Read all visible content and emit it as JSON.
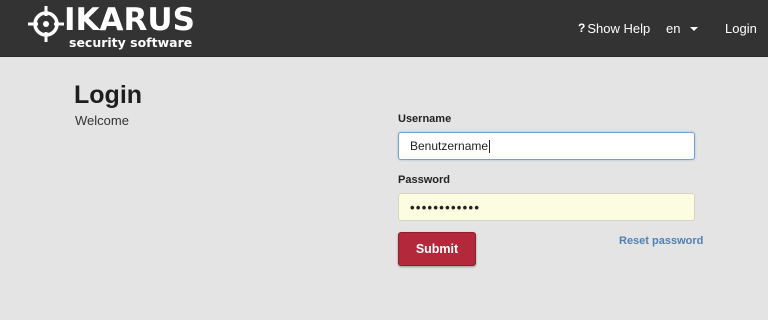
{
  "header": {
    "logo_word": "IKARUS",
    "logo_tagline": "security software",
    "help_icon": "question-mark-icon",
    "help_label": "Show Help",
    "language": "en",
    "login_label": "Login"
  },
  "main": {
    "title": "Login",
    "welcome": "Welcome"
  },
  "form": {
    "username_label": "Username",
    "username_value": "Benutzername",
    "password_label": "Password",
    "password_masked": "••••••••••••",
    "submit_label": "Submit",
    "reset_label": "Reset password"
  },
  "colors": {
    "topbar": "#333333",
    "background": "#e4e4e4",
    "submit": "#b3283a",
    "link": "#4f80b5"
  }
}
